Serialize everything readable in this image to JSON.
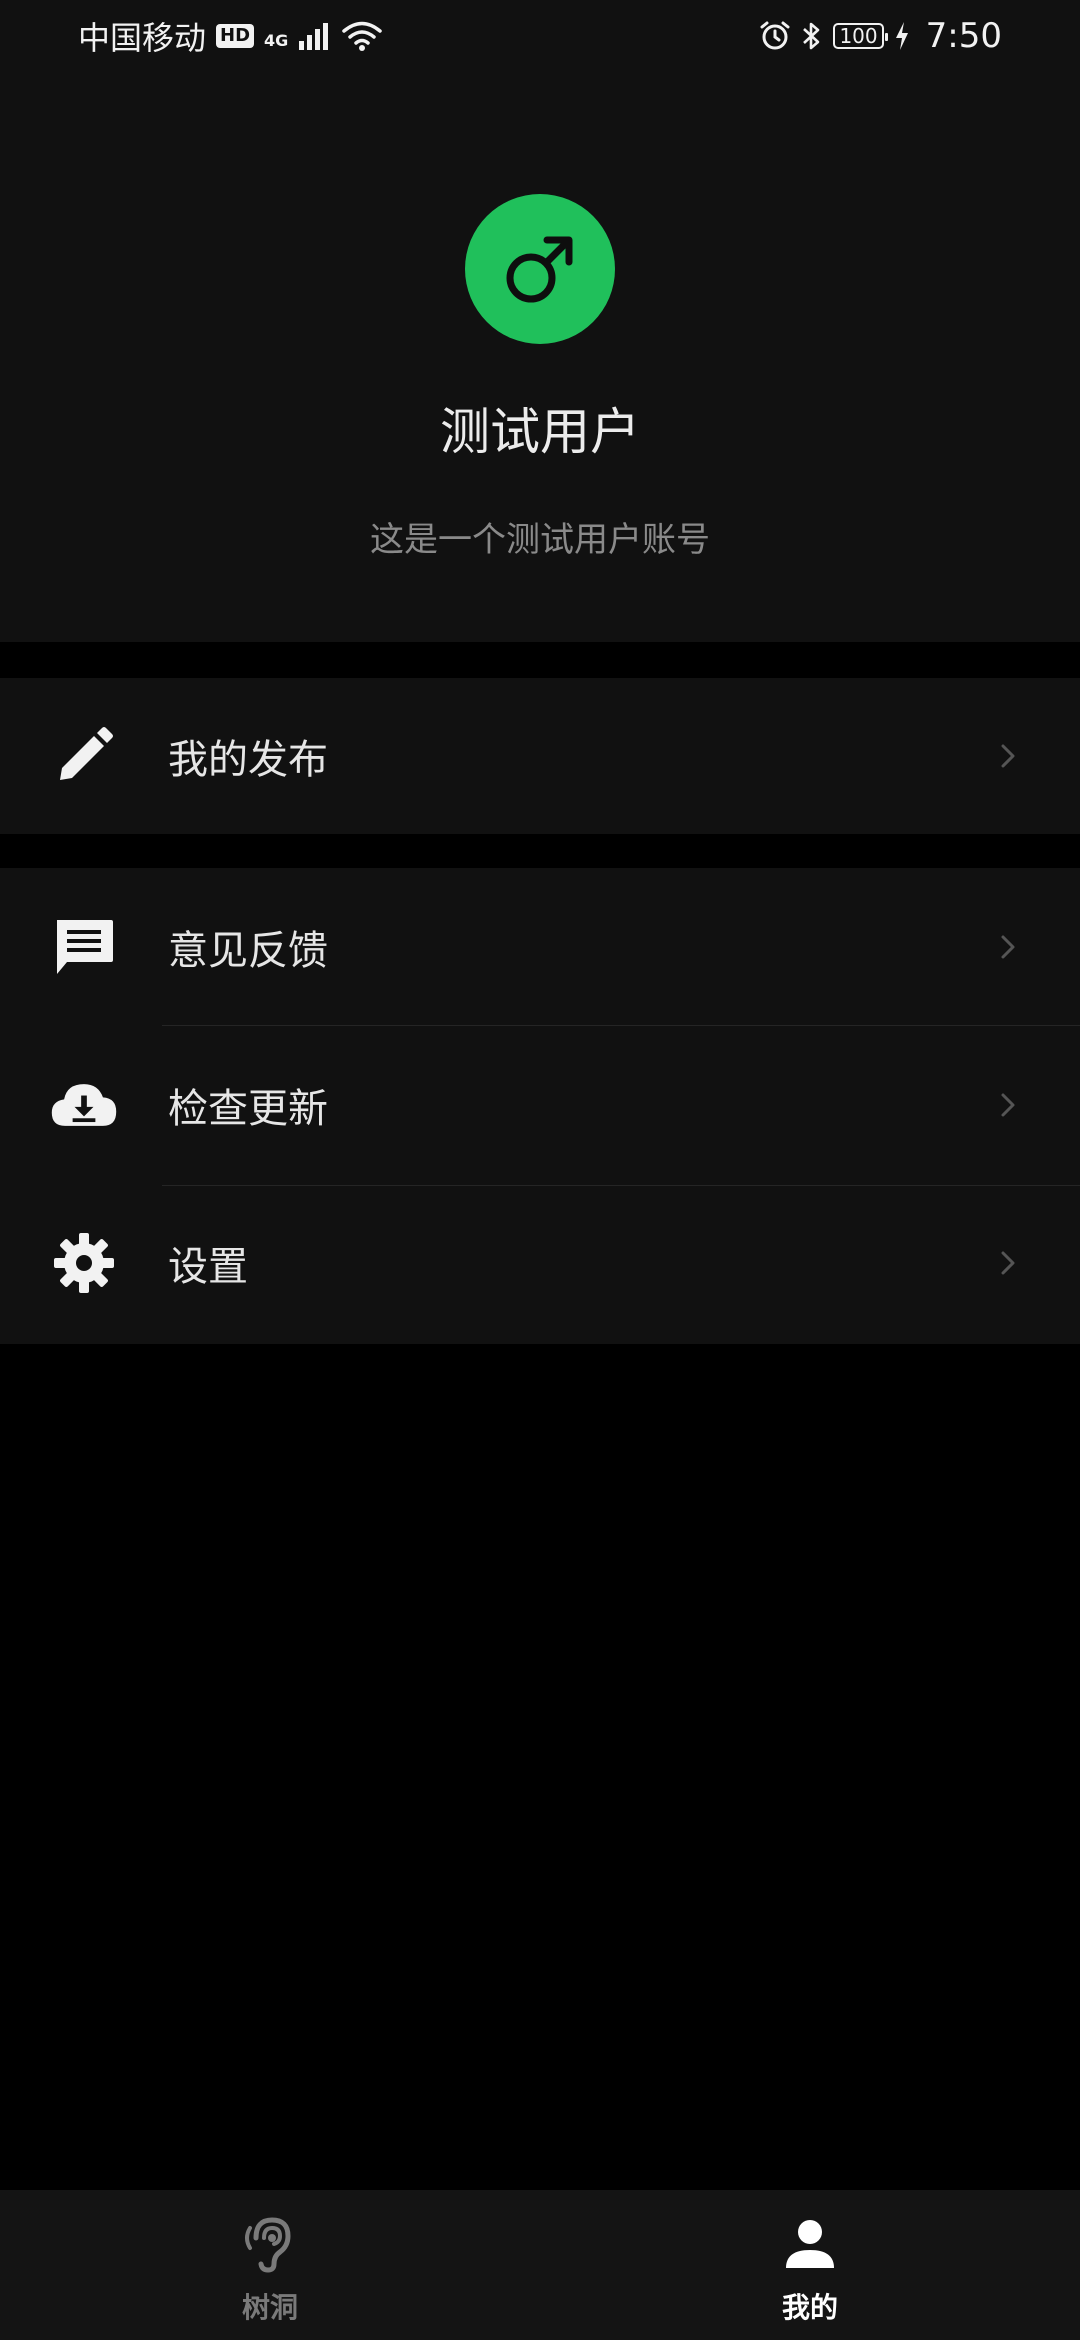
{
  "status_bar": {
    "carrier": "中国移动",
    "hd": "HD",
    "network": "4G",
    "battery": "100",
    "time": "7:50"
  },
  "profile": {
    "avatar_icon": "male-symbol-icon",
    "avatar_color": "#20c05b",
    "username": "测试用户",
    "bio": "这是一个测试用户账号"
  },
  "menu": {
    "group1": [
      {
        "label": "我的发布",
        "icon": "pencil-icon"
      }
    ],
    "group2": [
      {
        "label": "意见反馈",
        "icon": "chat-icon"
      },
      {
        "label": "检查更新",
        "icon": "cloud-download-icon"
      },
      {
        "label": "设置",
        "icon": "gear-icon"
      }
    ]
  },
  "bottom_nav": {
    "items": [
      {
        "label": "树洞",
        "icon": "ear-icon",
        "active": false
      },
      {
        "label": "我的",
        "icon": "person-icon",
        "active": true
      }
    ]
  }
}
